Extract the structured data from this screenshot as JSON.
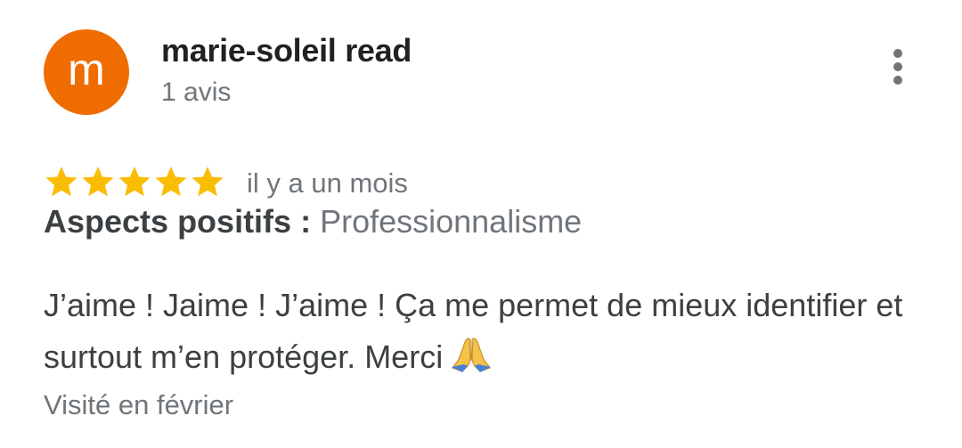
{
  "review": {
    "author": {
      "avatar_letter": "m",
      "avatar_color": "#ef6c00",
      "name": "marie-soleil read",
      "meta": "1 avis"
    },
    "more_icon": "more-vert-icon",
    "rating": {
      "stars": 5,
      "max": 5,
      "star_color": "#fbbc04",
      "icon": "star-icon"
    },
    "time_ago": "il y a un mois",
    "aspects": {
      "label": "Aspects positifs :",
      "value": "Professionnalisme"
    },
    "text": "J’aime ! Jaime ! J’aime ! Ça me permet de mieux identifier et surtout m’en protéger. Merci",
    "text_emoji": "folded-hands-icon",
    "visited": "Visité en février"
  }
}
